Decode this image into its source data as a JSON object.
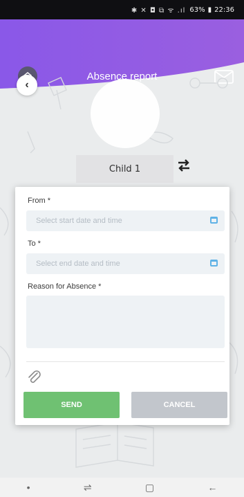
{
  "status_bar": {
    "icons_text": "✱ ✕ ◘ ⧉ ᯤ .ıl",
    "battery": "63%",
    "time": "22:36"
  },
  "header": {
    "title": "Absence report",
    "home_icon": "home-icon",
    "mail_icon": "mail-icon",
    "back_icon": "chevron-left-icon",
    "back_glyph": "‹"
  },
  "child": {
    "name": "Child 1",
    "switch_icon": "swap-icon"
  },
  "form": {
    "from_label": "From *",
    "from_placeholder": "Select start date and time",
    "to_label": "To *",
    "to_placeholder": "Select end date and time",
    "reason_label": "Reason for Absence *",
    "reason_value": "",
    "attach_icon": "paperclip-icon",
    "send_label": "SEND",
    "cancel_label": "CANCEL"
  },
  "nav_bar": {
    "dot": "•",
    "recent": "⇌",
    "home": "▢",
    "back": "←"
  },
  "colors": {
    "header_purple": "#8e56e6",
    "send_green": "#6fc172",
    "cancel_gray": "#c2c6cc",
    "accent_blue": "#5fb2e6"
  }
}
